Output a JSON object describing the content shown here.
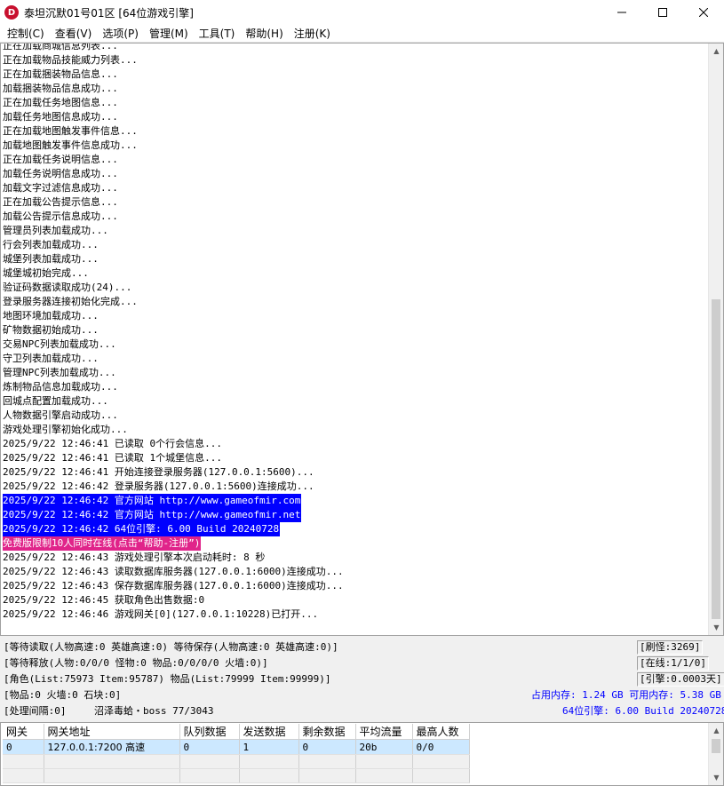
{
  "window": {
    "title": "泰坦沉默01号01区 [64位游戏引擎]",
    "app_icon_letter": "D"
  },
  "menu": [
    "控制(C)",
    "查看(V)",
    "选项(P)",
    "管理(M)",
    "工具(T)",
    "帮助(H)",
    "注册(K)"
  ],
  "log": {
    "lines": [
      {
        "text": "正在加载商城信息列表...",
        "style": ""
      },
      {
        "text": "正在加载物品技能威力列表...",
        "style": ""
      },
      {
        "text": "正在加载捆装物品信息...",
        "style": ""
      },
      {
        "text": "加载捆装物品信息成功...",
        "style": ""
      },
      {
        "text": "正在加载任务地图信息...",
        "style": ""
      },
      {
        "text": "加载任务地图信息成功...",
        "style": ""
      },
      {
        "text": "正在加载地图触发事件信息...",
        "style": ""
      },
      {
        "text": "加载地图触发事件信息成功...",
        "style": ""
      },
      {
        "text": "正在加载任务说明信息...",
        "style": ""
      },
      {
        "text": "加载任务说明信息成功...",
        "style": ""
      },
      {
        "text": "加载文字过滤信息成功...",
        "style": ""
      },
      {
        "text": "正在加载公告提示信息...",
        "style": ""
      },
      {
        "text": "加载公告提示信息成功...",
        "style": ""
      },
      {
        "text": "管理员列表加载成功...",
        "style": ""
      },
      {
        "text": "行会列表加载成功...",
        "style": ""
      },
      {
        "text": "城堡列表加载成功...",
        "style": ""
      },
      {
        "text": "城堡城初始完成...",
        "style": ""
      },
      {
        "text": "验证码数据读取成功(24)...",
        "style": ""
      },
      {
        "text": "登录服务器连接初始化完成...",
        "style": ""
      },
      {
        "text": "地图环境加载成功...",
        "style": ""
      },
      {
        "text": "矿物数据初始成功...",
        "style": ""
      },
      {
        "text": "交易NPC列表加载成功...",
        "style": ""
      },
      {
        "text": "守卫列表加载成功...",
        "style": ""
      },
      {
        "text": "管理NPC列表加载成功...",
        "style": ""
      },
      {
        "text": "炼制物品信息加载成功...",
        "style": ""
      },
      {
        "text": "回城点配置加载成功...",
        "style": ""
      },
      {
        "text": "人物数据引擎启动成功...",
        "style": ""
      },
      {
        "text": "游戏处理引擎初始化成功...",
        "style": ""
      },
      {
        "text": "2025/9/22 12:46:41 已读取 0个行会信息...",
        "style": ""
      },
      {
        "text": "2025/9/22 12:46:41 已读取 1个城堡信息...",
        "style": ""
      },
      {
        "text": "2025/9/22 12:46:41 开始连接登录服务器(127.0.0.1:5600)...",
        "style": ""
      },
      {
        "text": "2025/9/22 12:46:42 登录服务器(127.0.0.1:5600)连接成功...",
        "style": ""
      },
      {
        "text": "2025/9/22 12:46:42 官方网站 http://www.gameofmir.com",
        "style": "blue"
      },
      {
        "text": "2025/9/22 12:46:42 官方网站 http://www.gameofmir.net",
        "style": "blue"
      },
      {
        "text": "2025/9/22 12:46:42 64位引擎: 6.00 Build 20240728",
        "style": "blue"
      },
      {
        "text": "免费版限制10人同时在线(点击“帮助-注册”)",
        "style": "pink"
      },
      {
        "text": "2025/9/22 12:46:43 游戏处理引擎本次启动耗时: 8 秒",
        "style": ""
      },
      {
        "text": "2025/9/22 12:46:43 读取数据库服务器(127.0.0.1:6000)连接成功...",
        "style": ""
      },
      {
        "text": "2025/9/22 12:46:43 保存数据库服务器(127.0.0.1:6000)连接成功...",
        "style": ""
      },
      {
        "text": "2025/9/22 12:46:45 获取角色出售数据:0",
        "style": ""
      },
      {
        "text": "2025/9/22 12:46:46 游戏网关[0](127.0.0.1:10228)已打开...",
        "style": ""
      }
    ]
  },
  "status": {
    "row1_left": "[等待读取(人物高速:0 英雄高速:0) 等待保存(人物高速:0 英雄高速:0)]",
    "row1_right": "[刷怪:3269]",
    "row2_left": "[等待释放(人物:0/0/0 怪物:0 物品:0/0/0/0 火墙:0)]",
    "row2_right": "[在线:1/1/0]",
    "row3_left": "[角色(List:75973 Item:95787) 物品(List:79999 Item:99999)]",
    "row3_right": "[引擎:0.0003天]",
    "row4_left": "[物品:0 火墙:0 石块:0]",
    "row4_right": "占用内存: 1.24 GB 可用内存: 5.38 GB",
    "row5_left": "[处理间隔:0]",
    "row5_mid": "沼泽毒蛤・boss 77/3043",
    "row5_right": "64位引擎: 6.00 Build 20240728",
    "accent_color": "#0000ff"
  },
  "gateway_table": {
    "headers": [
      "网关",
      "网关地址",
      "队列数据",
      "发送数据",
      "剩余数据",
      "平均流量",
      "最高人数"
    ],
    "rows": [
      [
        "0",
        "127.0.0.1:7200 高速",
        "0",
        "1",
        "0",
        "20b",
        "0/0"
      ]
    ]
  },
  "colors": {
    "highlight_blue": "#0000ff",
    "highlight_pink": "#e0248a",
    "selected_row": "#cce8ff"
  }
}
